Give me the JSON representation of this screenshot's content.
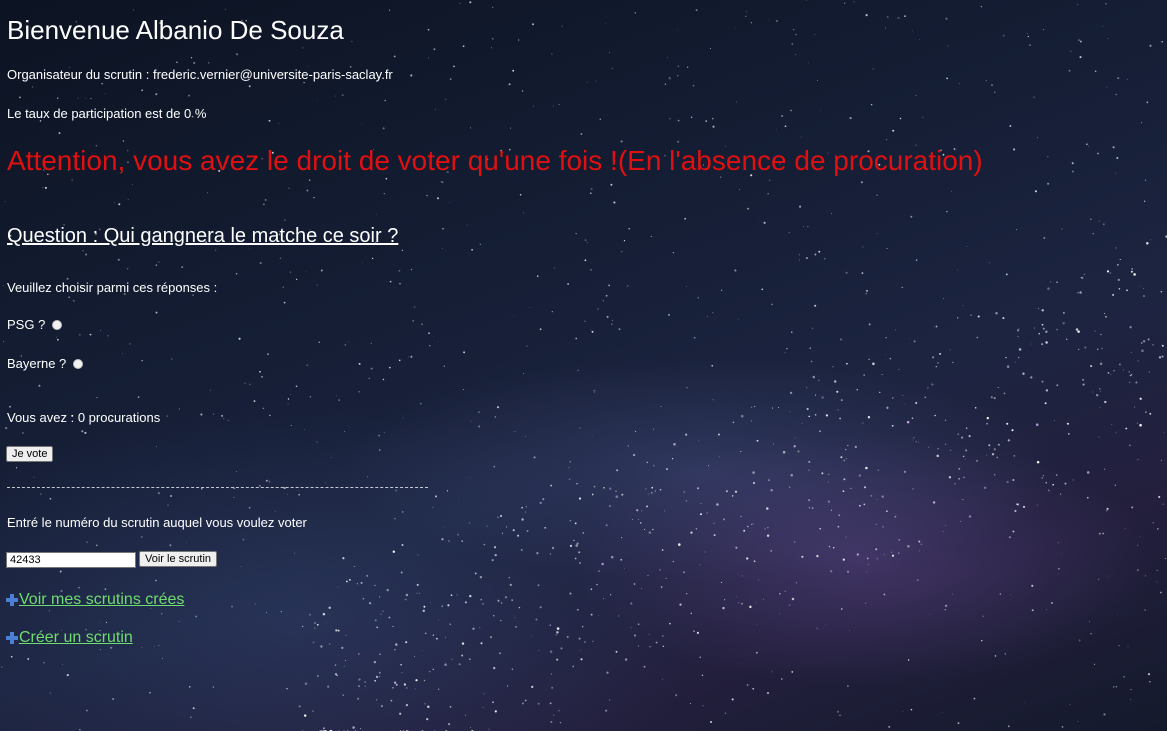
{
  "header": {
    "welcome": "Bienvenue Albanio De Souza",
    "organizer": "Organisateur du scrutin : frederic.vernier@universite-paris-saclay.fr",
    "participation": "Le taux de participation est de 0 %"
  },
  "warning": {
    "text": "Attention, vous avez le droit de voter qu'une fois !(En l'absence de procuration)",
    "color": "#e01010"
  },
  "question": {
    "title": "Question : Qui gangnera le matche ce soir ?",
    "instruction": "Veuillez choisir parmi ces réponses :",
    "options": [
      {
        "label": "PSG ?",
        "selected": false
      },
      {
        "label": "Bayerne ?",
        "selected": false
      }
    ]
  },
  "proxies": {
    "text": "Vous avez : 0 procurations"
  },
  "vote": {
    "button_label": "Je vote"
  },
  "ballot_lookup": {
    "instruction": "Entré le numéro du scrutin auquel vous voulez voter",
    "input_value": "42433",
    "button_label": "Voir le scrutin"
  },
  "links": {
    "my_ballots": "Voir mes scrutins crées",
    "create_ballot": "Créer un scrutin",
    "icon": "plus-icon",
    "color": "#6fdc6f"
  }
}
